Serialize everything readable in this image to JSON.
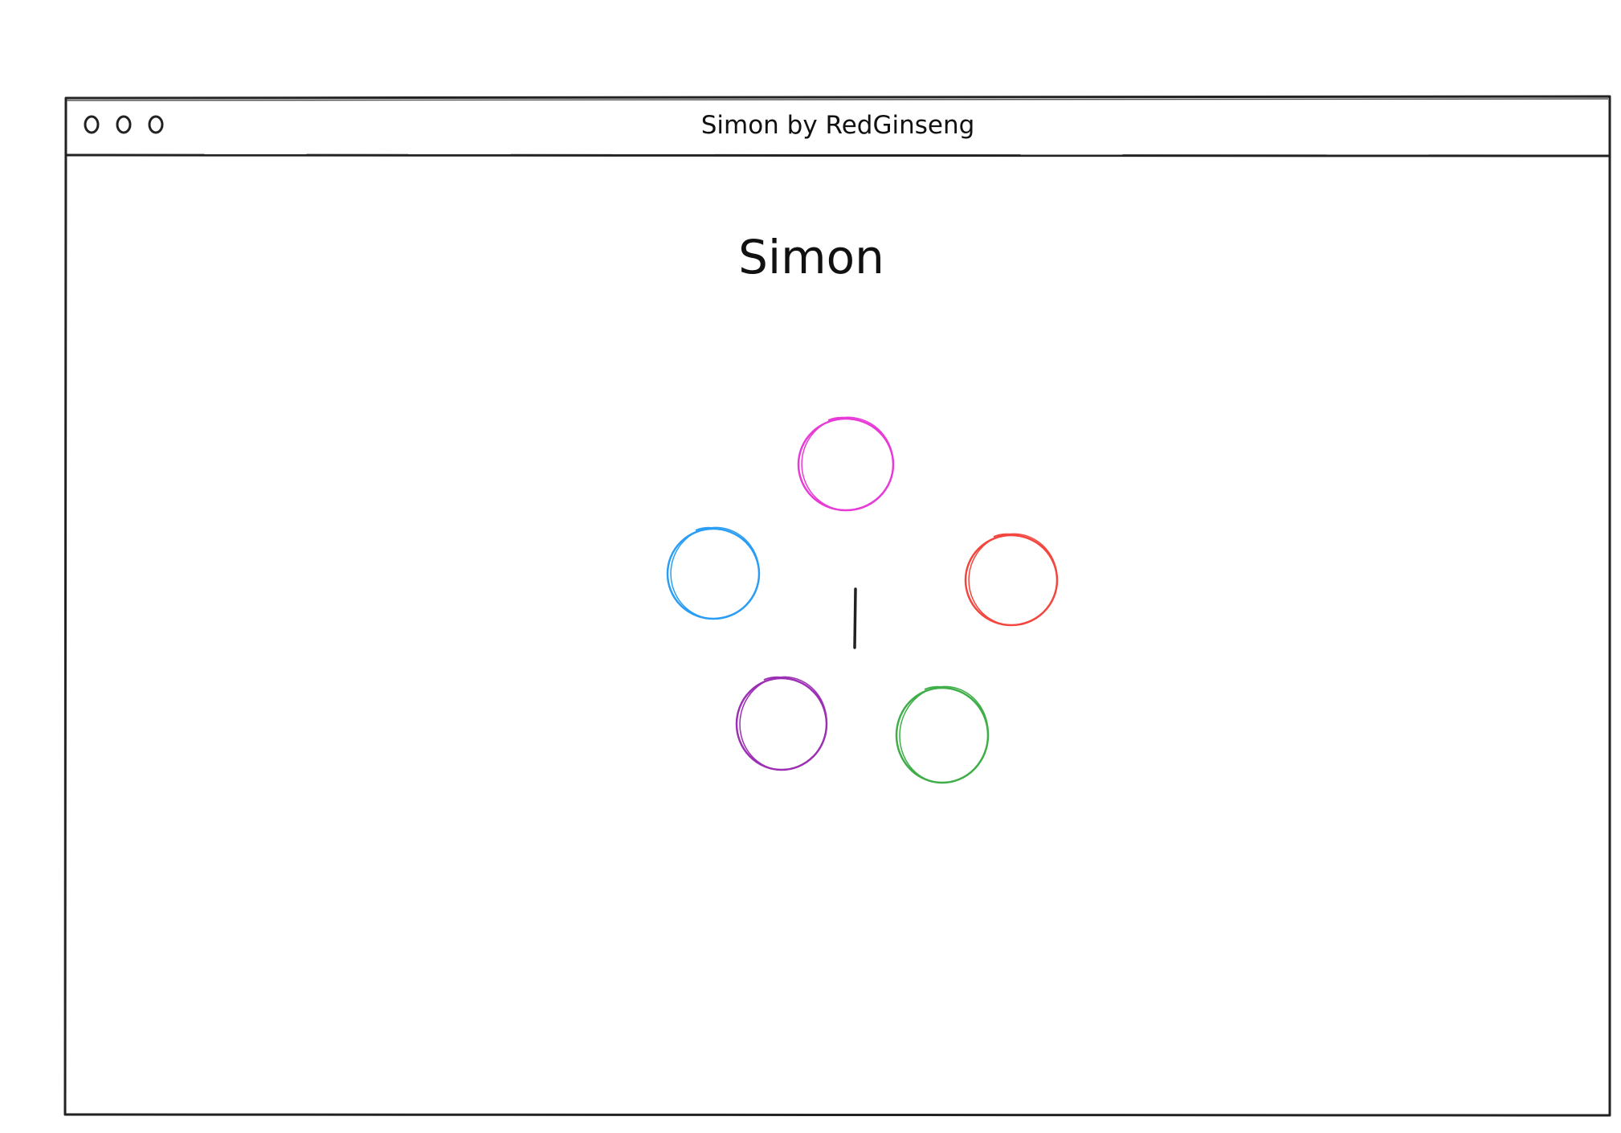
{
  "window": {
    "title": "Simon by RedGinseng",
    "controls": [
      "window-dot",
      "window-dot",
      "window-dot"
    ]
  },
  "main": {
    "heading": "Simon",
    "center_mark": "|",
    "buttons": [
      {
        "name": "simon-button-pink",
        "color": "#e83ad6"
      },
      {
        "name": "simon-button-blue",
        "color": "#2a9df4"
      },
      {
        "name": "simon-button-red",
        "color": "#f2463f"
      },
      {
        "name": "simon-button-purple",
        "color": "#9c2fb4"
      },
      {
        "name": "simon-button-green",
        "color": "#3fae49"
      }
    ]
  }
}
